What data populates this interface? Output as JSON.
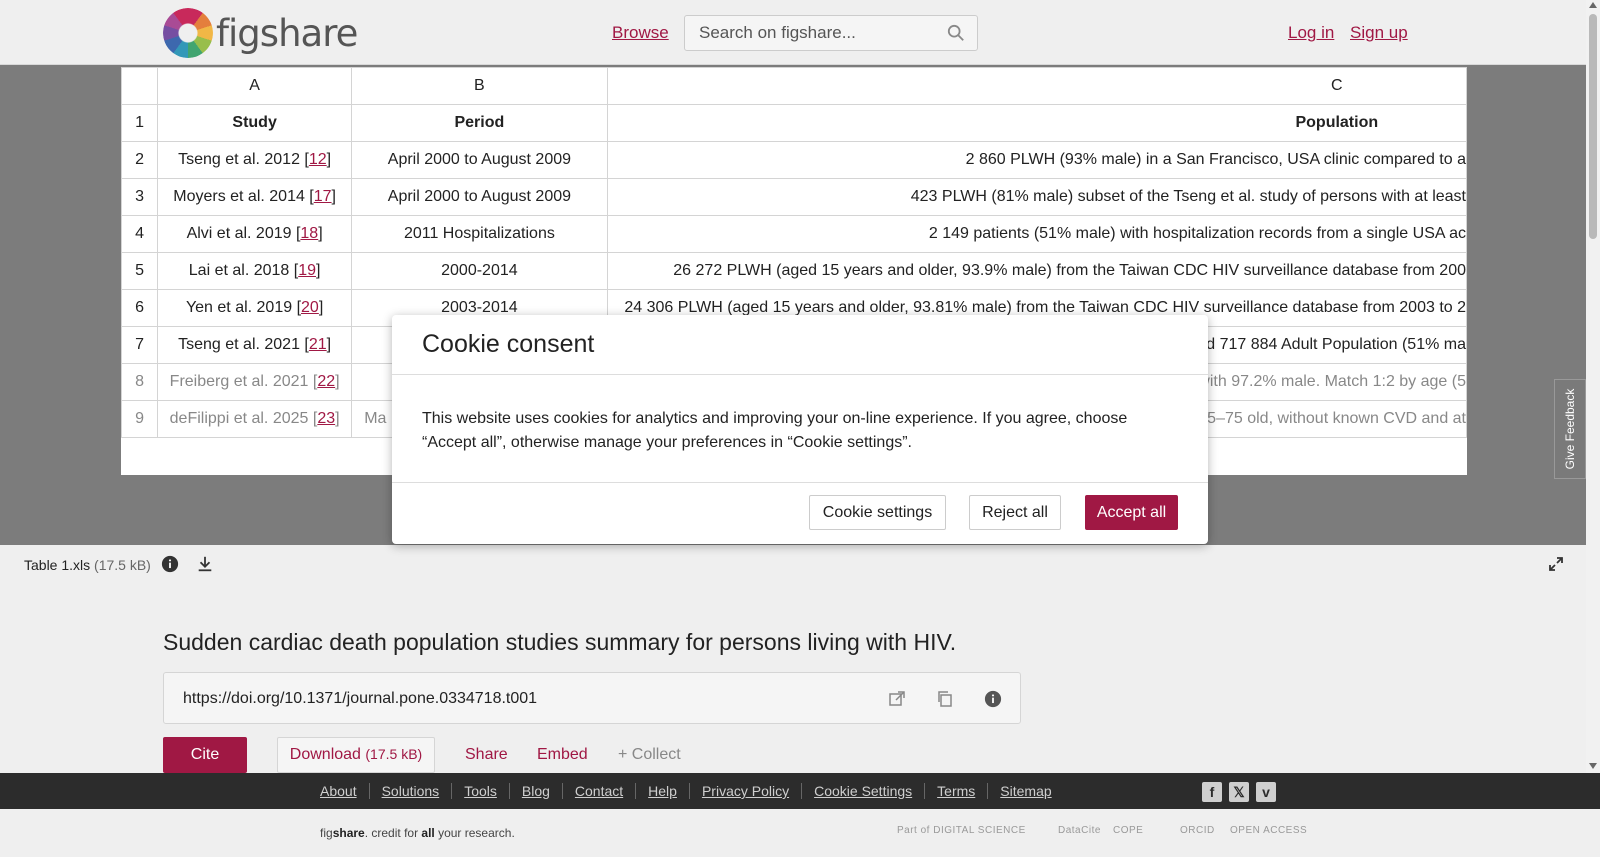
{
  "header": {
    "logo_text": "figshare",
    "browse": "Browse",
    "search_placeholder": "Search on figshare...",
    "login": "Log in",
    "signup": "Sign up"
  },
  "sheet": {
    "col_headers": [
      "A",
      "B",
      "C"
    ],
    "header_row": {
      "num": "1",
      "study": "Study",
      "period": "Period",
      "population": "Population"
    },
    "rows": [
      {
        "num": "2",
        "study": "Tseng et al. 2012 [",
        "ref": "12",
        "period": "April 2000 to August 2009",
        "population": "2 860 PLWH (93% male) in a San Francisco, USA clinic compared to a"
      },
      {
        "num": "3",
        "study": "Moyers et al. 2014 [",
        "ref": "17",
        "period": "April 2000 to August 2009",
        "population": "423 PLWH (81% male) subset of the Tseng et al. study of persons with at least"
      },
      {
        "num": "4",
        "study": "Alvi et al. 2019 [",
        "ref": "18",
        "period": "2011 Hospitalizations",
        "population": "2 149 patients (51% male) with hospitalization records from a single USA ac"
      },
      {
        "num": "5",
        "study": "Lai et al. 2018 [",
        "ref": "19",
        "period": "2000-2014",
        "population": "26 272 PLWH (aged 15 years and older, 93.9% male) from the Taiwan CDC HIV surveillance database from 200"
      },
      {
        "num": "6",
        "study": "Yen et al. 2019 [",
        "ref": "20",
        "period": "2003-2014",
        "population": "24 306 PLWH (aged 15 years and older, 93.81% male) from the Taiwan CDC HIV surveillance database from 2003 to 2"
      },
      {
        "num": "7",
        "study": "Tseng et al. 2021 [",
        "ref": "21",
        "period": "",
        "population": "d 717 884 Adult Population (51% ma"
      },
      {
        "num": "8",
        "study": "Freiberg et al. 2021 [",
        "ref": "22",
        "period": "",
        "population": "with 97.2% male. Match 1:2 by age (5"
      },
      {
        "num": "9",
        "study": "deFilippi et al. 2025 [",
        "ref": "23",
        "period": "Ma",
        "population": "5–75 old, without known CVD and at"
      }
    ]
  },
  "file": {
    "name": "Table 1.xls",
    "size": "(17.5 kB)"
  },
  "article": {
    "title": "Sudden cardiac death population studies summary for persons living with HIV.",
    "doi": "https://doi.org/10.1371/journal.pone.0334718.t001",
    "cite": "Cite",
    "download": "Download",
    "download_size": "(17.5 kB)",
    "share": "Share",
    "embed": "Embed",
    "collect": "+ Collect"
  },
  "footer": {
    "links": [
      "About",
      "Solutions",
      "Tools",
      "Blog",
      "Contact",
      "Help",
      "Privacy Policy",
      "Cookie Settings",
      "Terms",
      "Sitemap"
    ],
    "tagline_pre": "fig",
    "tagline_bold": "share",
    "tagline_mid": ". credit for ",
    "tagline_all": "all",
    "tagline_end": " your research.",
    "partners": [
      "Part of DIGITAL SCIENCE",
      "DataCite",
      "COPE",
      "ORCID",
      "OPEN ACCESS"
    ]
  },
  "feedback": "Give Feedback",
  "modal": {
    "title": "Cookie consent",
    "text": "This website uses cookies for analytics and improving your on-line experience. If you agree, choose “Accept all”, otherwise manage your preferences in “Cookie settings”.",
    "settings": "Cookie settings",
    "reject": "Reject all",
    "accept": "Accept all"
  },
  "colors": {
    "accent": "#a01844",
    "footer_bg": "#2c2c2c"
  }
}
